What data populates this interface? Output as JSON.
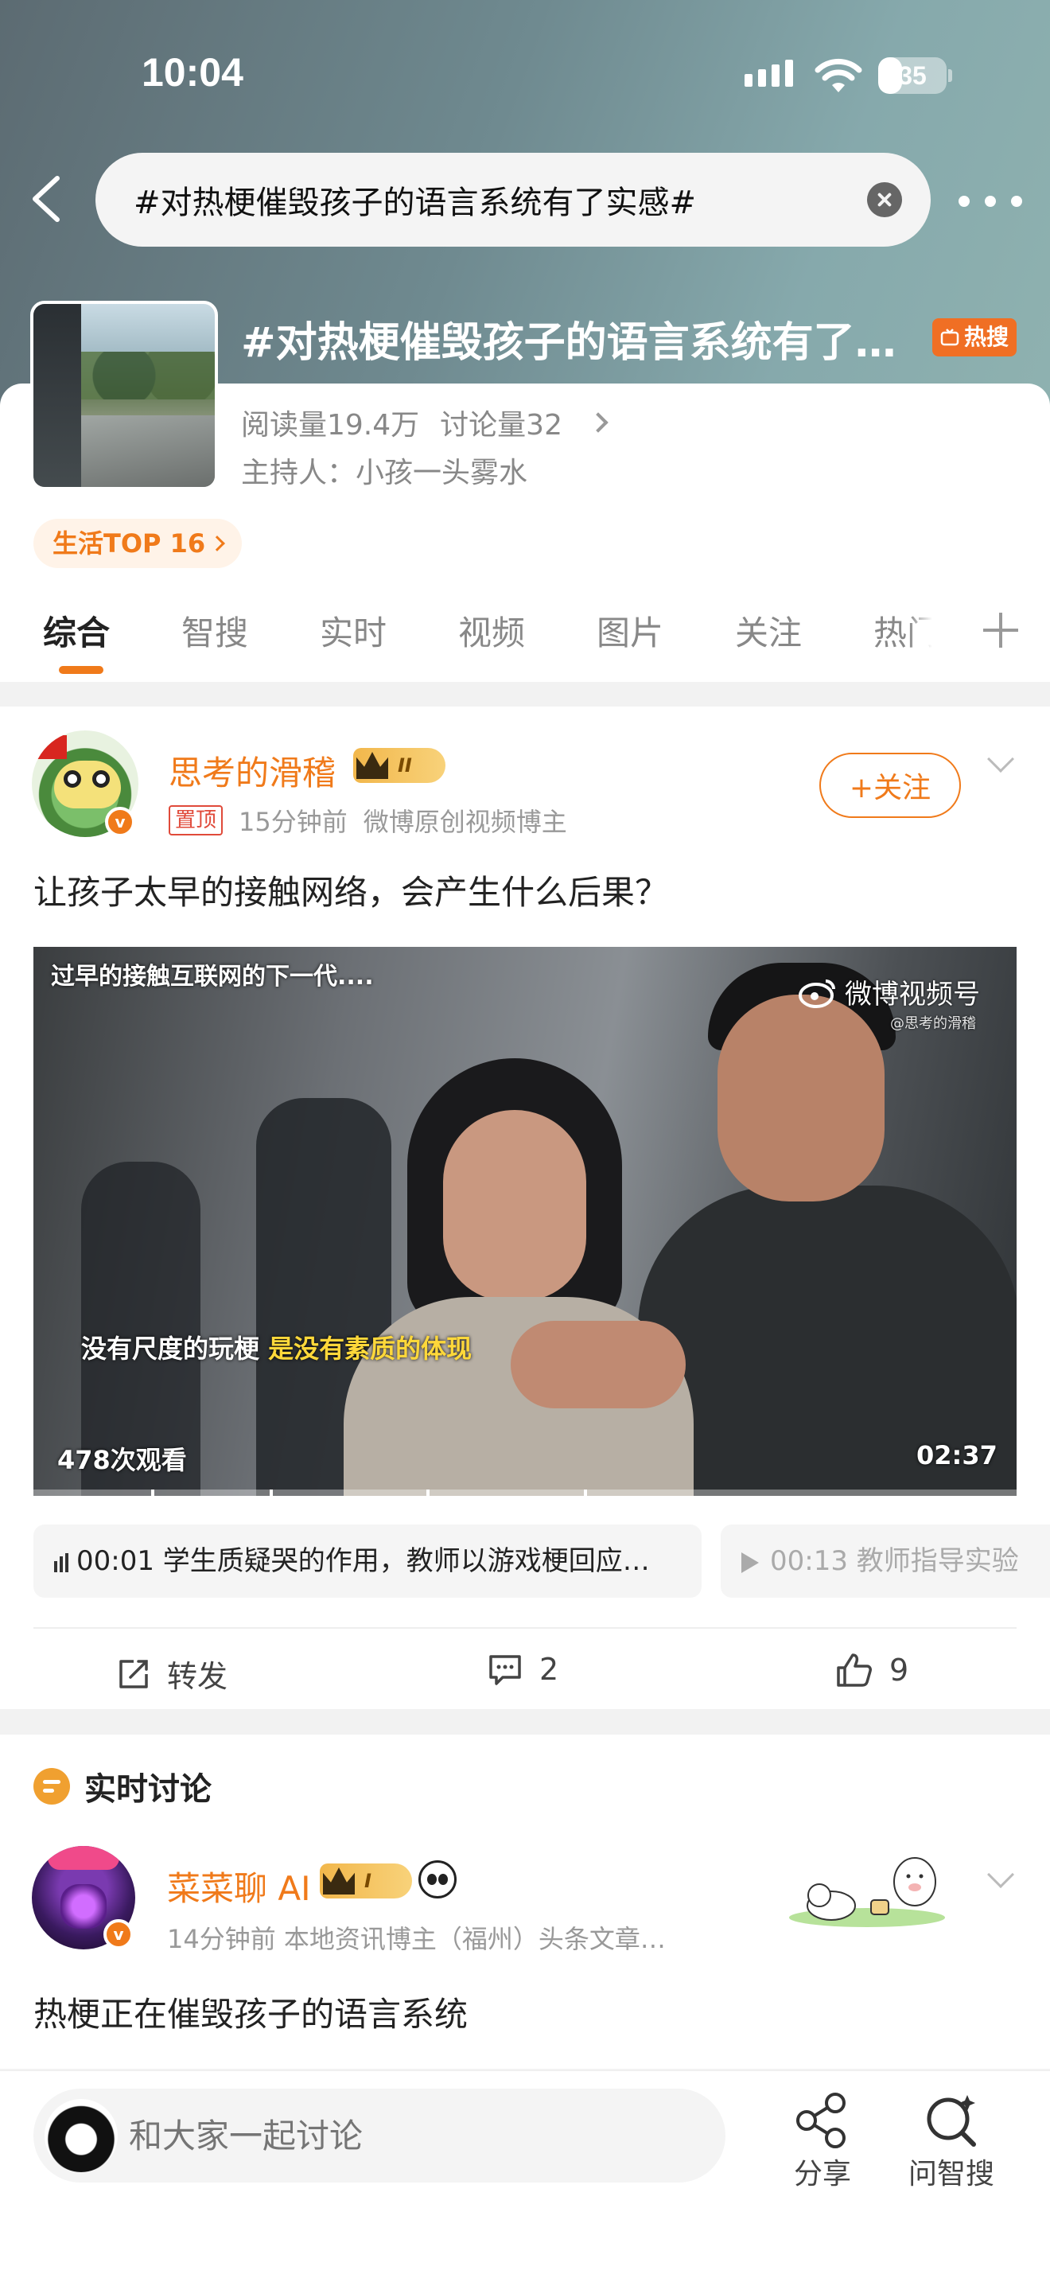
{
  "status_bar": {
    "time": "10:04",
    "battery": "35",
    "battery_level": 0.35
  },
  "search": {
    "value": "#对热梗催毁孩子的语言系统有了实感#"
  },
  "topic": {
    "title": "#对热梗催毁孩子的语言系统有了…",
    "hot_badge": "热搜",
    "reads": "阅读量19.4万",
    "discussions": "讨论量32",
    "host": "主持人：小孩一头雾水",
    "rank_tag": "生活TOP 16"
  },
  "tabs": [
    "综合",
    "智搜",
    "实时",
    "视频",
    "图片",
    "关注",
    "热门"
  ],
  "post": {
    "username": "思考的滑稽",
    "level": "II",
    "pin": "置顶",
    "time": "15分钟前",
    "source": "微博原创视频博主",
    "follow_label": "+关注",
    "text": "让孩子太早的接触网络，会产生什么后果？",
    "video": {
      "caption_top": "过早的接触互联网的下一代....",
      "caption_mid_plain": "没有尺度的玩梗",
      "caption_mid_highlight": "是没有素质的体现",
      "watermark": "微博视频号",
      "watermark_sub": "@思考的滑稽",
      "views": "478次观看",
      "duration": "02:37"
    },
    "chapters": [
      {
        "label": "00:01 学生质疑哭的作用，教师以游戏梗回应…"
      },
      {
        "label": "00:13 教师指导实验"
      }
    ],
    "actions": {
      "repost": "转发",
      "comments": "2",
      "likes": "9"
    }
  },
  "realtime": {
    "header": "实时讨论",
    "username": "菜菜聊 AI",
    "level": "I",
    "meta": "14分钟前  本地资讯博主（福州）头条文章…",
    "text": "热梗正在催毁孩子的语言系统"
  },
  "bottom": {
    "comment_placeholder": "和大家一起讨论",
    "share_label": "分享",
    "ask_label": "问智搜"
  },
  "colors": {
    "accent": "#f07a1a",
    "hot": "#f06f24"
  }
}
